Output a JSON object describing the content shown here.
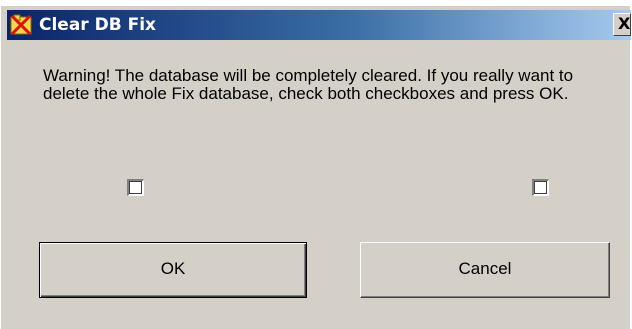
{
  "window": {
    "title": "Clear DB Fix",
    "close_label": "X",
    "app_icon": "crossed-tool-icon",
    "title_bar_colors": [
      "#0a246a",
      "#a6caf0"
    ]
  },
  "dialog": {
    "message": "Warning! The database will be completely cleared. If you really want to delete the whole Fix database, check both checkboxes and press OK.",
    "checkbox_left_checked": false,
    "checkbox_right_checked": false,
    "ok_label": "OK",
    "cancel_label": "Cancel"
  }
}
